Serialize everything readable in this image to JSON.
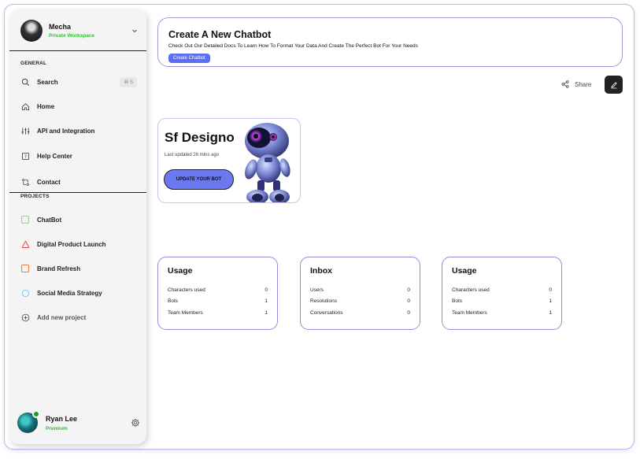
{
  "workspace": {
    "name": "Mecha",
    "subtitle": "Private Workspace"
  },
  "sidebar": {
    "general_label": "GENERAL",
    "general_items": [
      {
        "label": "Search",
        "shortcut": "⌘ S",
        "icon": "search-icon"
      },
      {
        "label": "Home",
        "icon": "home-icon"
      },
      {
        "label": "API and Integration",
        "icon": "sliders-icon"
      },
      {
        "label": "Help Center",
        "icon": "help-icon"
      },
      {
        "label": "Contact",
        "icon": "contact-icon"
      }
    ],
    "projects_label": "PROJECTS",
    "projects": [
      {
        "label": "ChatBot",
        "color": "#8fd58f",
        "shape": "square"
      },
      {
        "label": "Digital Product Launch",
        "color": "#e23b3b",
        "shape": "triangle"
      },
      {
        "label": "Brand Refresh",
        "color": "#ef7a3b",
        "shape": "square"
      },
      {
        "label": "Social Media Strategy",
        "color": "#7cc3ef",
        "shape": "circle"
      }
    ],
    "add_project": "Add new project"
  },
  "user": {
    "name": "Ryan Lee",
    "plan": "Premium"
  },
  "banner": {
    "title": "Create A New Chatbot",
    "description": "Check Out Our Detailed Docs To Learn How To Format Your Data And Create The Perfect Bot For Your Needs",
    "button": "Create Chatbot"
  },
  "toolbar": {
    "share": "Share"
  },
  "bot": {
    "name": "Sf Designo",
    "updated": "Last updated 26 mins ago",
    "button": "UPDATE YOUR BOT"
  },
  "cards": [
    {
      "title": "Usage",
      "rows": [
        {
          "label": "Characters used",
          "value": "0"
        },
        {
          "label": "Bots",
          "value": "1"
        },
        {
          "label": "Team Members",
          "value": "1"
        }
      ]
    },
    {
      "title": "Inbox",
      "rows": [
        {
          "label": "Users",
          "value": "0"
        },
        {
          "label": "Resolutions",
          "value": "0"
        },
        {
          "label": "Conversations",
          "value": "0"
        }
      ]
    },
    {
      "title": "Usage",
      "rows": [
        {
          "label": "Characters used",
          "value": "0"
        },
        {
          "label": "Bots",
          "value": "1"
        },
        {
          "label": "Team Members",
          "value": "1"
        }
      ]
    }
  ],
  "colors": {
    "accent": "#5b6ff0",
    "status_green": "#2fc32f",
    "border": "#9a9ae0"
  }
}
